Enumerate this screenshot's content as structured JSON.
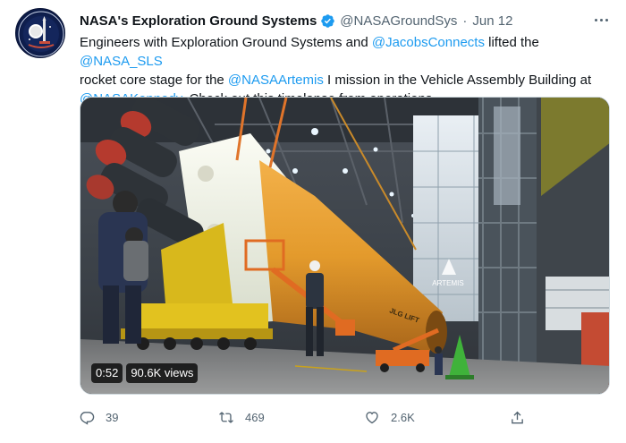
{
  "author": {
    "display_name": "NASA's Exploration Ground Systems",
    "handle": "@NASAGroundSys",
    "separator": "·",
    "date": "Jun 12",
    "verified_icon": "verified-badge-icon",
    "brand_color": "#1d9bf0"
  },
  "tweet": {
    "text_1": "Engineers with Exploration Ground Systems and ",
    "mention_1": "@JacobsConnects",
    "text_2": " lifted the ",
    "mention_2": "@NASA_SLS",
    "text_3": " rocket core stage for the ",
    "mention_3": "@NASAArtemis",
    "text_4": " I mission in the Vehicle Assembly Building at ",
    "mention_4": "@NASAKennedy",
    "text_5": ". Check out this timelapse from operations."
  },
  "media": {
    "overlay_text_1": "ARTEMIS",
    "overlay_text_2": "JLG LIFT",
    "duration": "0:52",
    "views": "90.6K views"
  },
  "actions": {
    "reply_count": "39",
    "retweet_count": "469",
    "like_count": "2.6K",
    "reply_icon": "reply-icon",
    "retweet_icon": "retweet-icon",
    "like_icon": "heart-icon",
    "share_icon": "share-icon"
  }
}
